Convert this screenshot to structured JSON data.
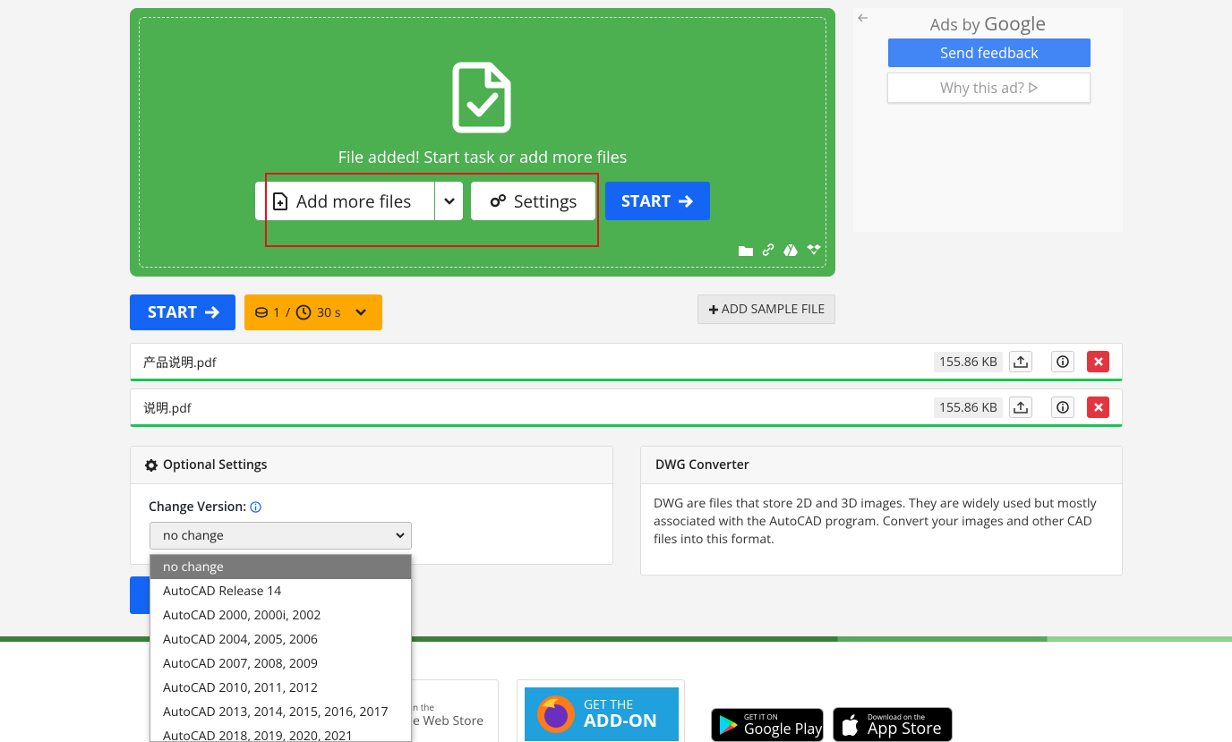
{
  "dropzone": {
    "message": "File added! Start task or add more files",
    "add_more_label": "Add more files",
    "settings_label": "Settings",
    "start_label": "START"
  },
  "ads": {
    "ads_by": "Ads by",
    "google": "Google",
    "send_feedback": "Send feedback",
    "why_this_ad": "Why this ad?"
  },
  "toolbar": {
    "start_label": "START",
    "credits_count": "1",
    "credits_sep": "/",
    "time_label": "30 s",
    "add_sample_label": "ADD SAMPLE FILE"
  },
  "files": [
    {
      "name": "产品说明.pdf",
      "size": "155.86 KB"
    },
    {
      "name": "说明.pdf",
      "size": "155.86 KB"
    }
  ],
  "optional_settings": {
    "title": "Optional Settings",
    "change_version_label": "Change Version:",
    "selected_version": "no change",
    "options": [
      "no change",
      "AutoCAD Release 14",
      "AutoCAD 2000, 2000i, 2002",
      "AutoCAD 2004, 2005, 2006",
      "AutoCAD 2007, 2008, 2009",
      "AutoCAD 2010, 2011, 2012",
      "AutoCAD 2013, 2014, 2015, 2016, 2017",
      "AutoCAD 2018, 2019, 2020, 2021"
    ]
  },
  "dwg_card": {
    "title": "DWG Converter",
    "description": "DWG are files that store 2D and 3D images. They are widely used but mostly associated with the AutoCAD program. Convert your images and other CAD files into this format."
  },
  "footer": {
    "chrome_line1": "n the",
    "chrome_line2": "e Web Store",
    "firefox_line1": "GET THE",
    "firefox_line2": "ADD-ON",
    "gplay_small": "GET IT ON",
    "gplay_big": "Google Play",
    "appstore_small": "Download on the",
    "appstore_big": "App Store"
  },
  "colors": {
    "dropzone_green": "#4caf50",
    "primary_blue": "#1565f5",
    "credits_orange": "#ffa801",
    "progress_green": "#17c656",
    "remove_red": "#e3353f",
    "highlight_red": "#e0141e"
  }
}
